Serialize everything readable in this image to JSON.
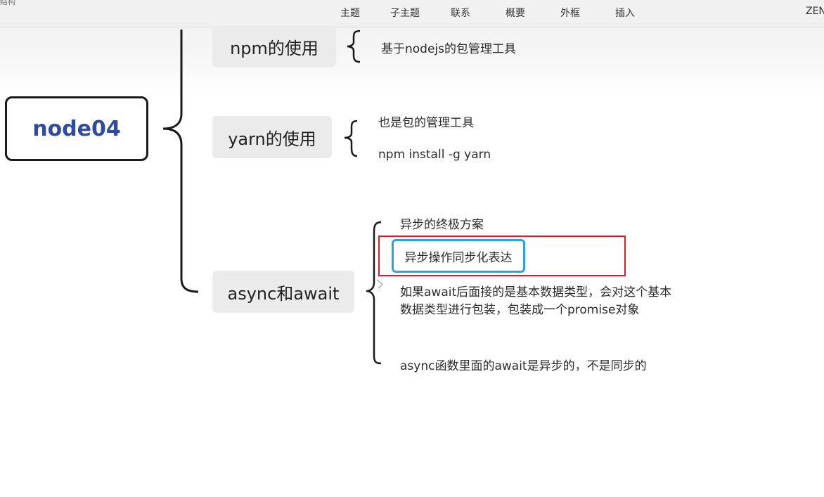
{
  "toolbar": {
    "corner_text": "结构",
    "items": [
      "主题",
      "子主题",
      "联系",
      "概要",
      "外框",
      "插入"
    ],
    "brand": "ZEN"
  },
  "mindmap": {
    "root": "node04",
    "topics": [
      {
        "label": "npm的使用",
        "children": [
          "基于nodejs的包管理工具"
        ]
      },
      {
        "label": "yarn的使用",
        "children": [
          "也是包的管理工具",
          "npm install -g yarn"
        ]
      },
      {
        "label": "async和await",
        "children": [
          "异步的终极方案",
          "异步操作同步化表达",
          "如果await后面接的是基本数据类型，会对这个基本数据类型进行包装，包装成一个promise对象",
          "async函数里面的await是异步的，不是同步的"
        ]
      }
    ],
    "selected_child": "异步操作同步化表达"
  },
  "colors": {
    "root_text": "#2f4aa0",
    "selection_border": "#2fa2d8",
    "annotation_box": "#d21f2a",
    "topic_bg": "#ebebeb"
  }
}
